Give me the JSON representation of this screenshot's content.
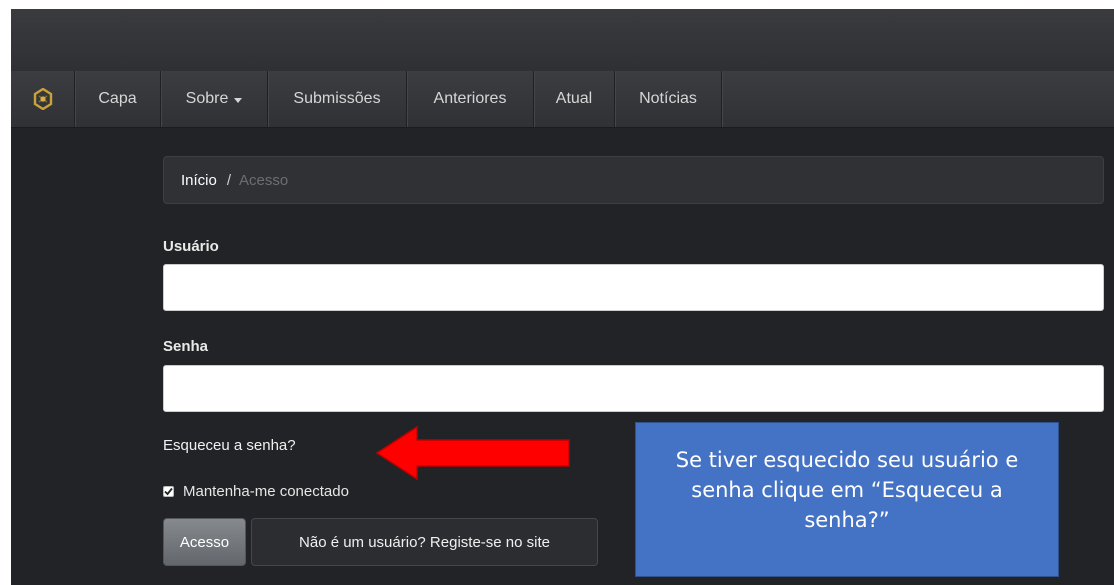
{
  "nav": {
    "logo_icon": "ojs-logo-icon",
    "items": [
      {
        "label": "Capa"
      },
      {
        "label": "Sobre",
        "has_dropdown": true
      },
      {
        "label": "Submissões"
      },
      {
        "label": "Anteriores"
      },
      {
        "label": "Atual"
      },
      {
        "label": "Notícias"
      }
    ]
  },
  "breadcrumb": {
    "home": "Início",
    "separator": "/",
    "current": "Acesso"
  },
  "form": {
    "username_label": "Usuário",
    "username_value": "",
    "password_label": "Senha",
    "password_value": "",
    "forgot_link": "Esqueceu a senha?",
    "remember_label": "Mantenha-me conectado",
    "remember_checked": true,
    "login_button": "Acesso",
    "register_button": "Não é um usuário? Registe-se no site"
  },
  "annotation": {
    "arrow_color": "#ff0000",
    "callout_text": "Se tiver esquecido seu usuário e senha clique em “Esqueceu a senha?”",
    "callout_color": "#4472c4"
  }
}
